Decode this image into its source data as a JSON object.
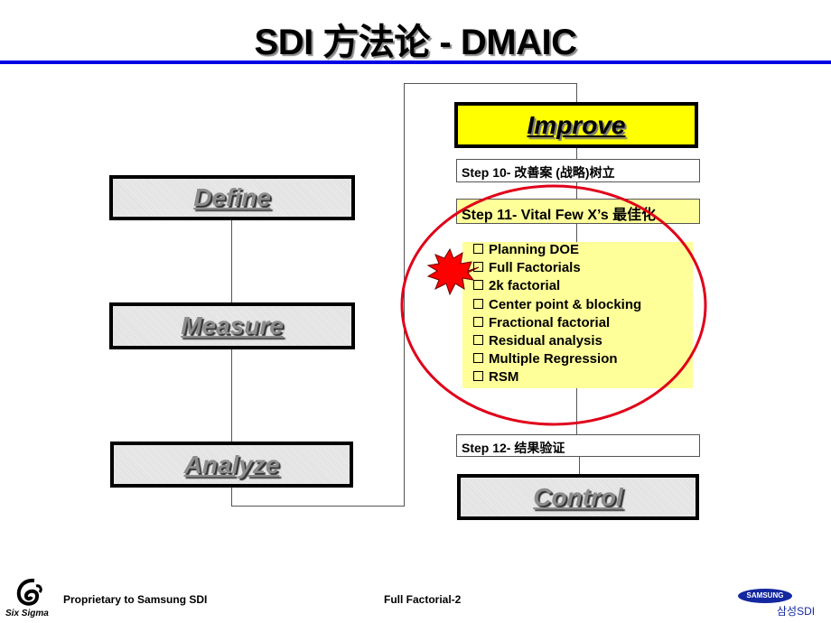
{
  "title": "SDI 方法论 - DMAIC",
  "phases": {
    "define": "Define",
    "measure": "Measure",
    "analyze": "Analyze",
    "improve": "Improve",
    "control": "Control"
  },
  "steps": {
    "step10": "Step 10- 改善案 (战略)树立",
    "step11": "Step 11- Vital Few X’s 最佳化",
    "step12": "Step 12- 结果验证"
  },
  "step11_items": [
    "Planning DOE",
    "Full Factorials",
    "2k factorial",
    "Center point & blocking",
    "Fractional factorial",
    "Residual analysis",
    "Multiple Regression",
    "RSM"
  ],
  "highlight": {
    "marker": "starburst-icon",
    "marked_item": "Full Factorials",
    "circle_color": "#e0001a"
  },
  "colors": {
    "rule": "#0000e6",
    "active_phase": "#ffff00",
    "step11_fill": "#ffff99"
  },
  "footer": {
    "logo_label": "Six Sigma",
    "left": "Proprietary to Samsung SDI",
    "center": "Full Factorial-2",
    "brand": "SAMSUNG",
    "brand_sub": "삼성SDI"
  }
}
